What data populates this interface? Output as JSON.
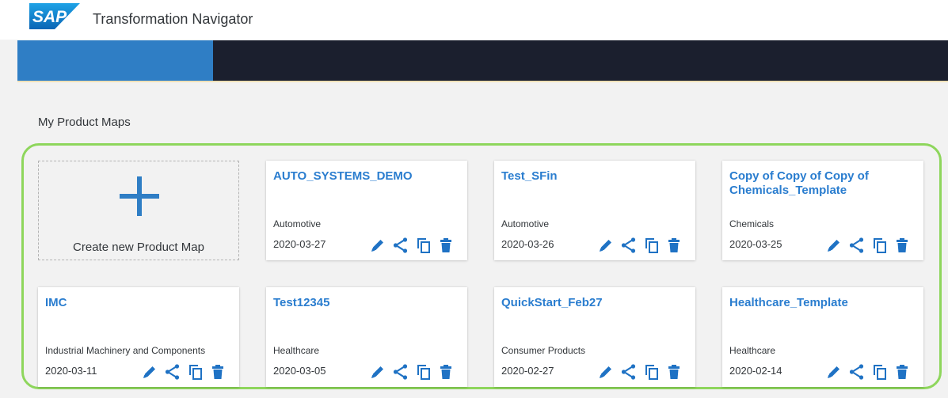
{
  "header": {
    "logo_text": "SAP",
    "app_title": "Transformation Navigator"
  },
  "colors": {
    "brand_blue": "#2f7ec5",
    "navbar_dark": "#1b1f2e",
    "link_blue": "#2a7dcf",
    "icon_blue": "#1f72c4",
    "highlight_green": "#8ed65c"
  },
  "main": {
    "section_title": "My Product Maps",
    "create_tile": {
      "label": "Create new Product Map",
      "icon": "plus-icon"
    },
    "card_action_icons": [
      "edit-icon",
      "share-icon",
      "copy-icon",
      "delete-icon"
    ],
    "cards": [
      {
        "title": "AUTO_SYSTEMS_DEMO",
        "industry": "Automotive",
        "date": "2020-03-27"
      },
      {
        "title": "Test_SFin",
        "industry": "Automotive",
        "date": "2020-03-26"
      },
      {
        "title": "Copy of Copy of Copy of Chemicals_Template",
        "industry": "Chemicals",
        "date": "2020-03-25"
      },
      {
        "title": "IMC",
        "industry": "Industrial Machinery and Components",
        "date": "2020-03-11"
      },
      {
        "title": "Test12345",
        "industry": "Healthcare",
        "date": "2020-03-05"
      },
      {
        "title": "QuickStart_Feb27",
        "industry": "Consumer Products",
        "date": "2020-02-27"
      },
      {
        "title": "Healthcare_Template",
        "industry": "Healthcare",
        "date": "2020-02-14"
      }
    ]
  }
}
